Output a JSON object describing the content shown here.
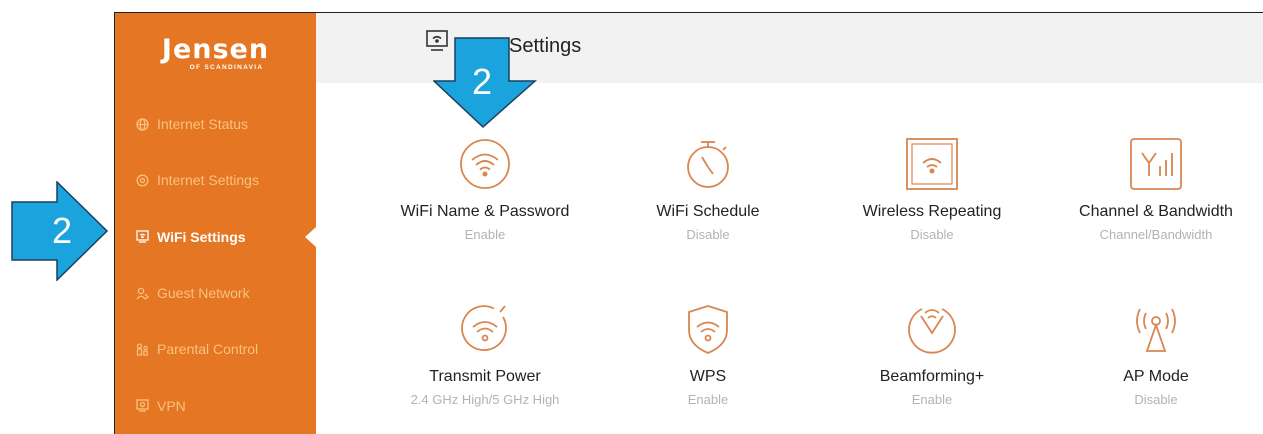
{
  "brand": {
    "name": "Jensen",
    "tagline": "OF SCANDINAVIA"
  },
  "sidebar": {
    "items": [
      {
        "label": "Internet Status",
        "icon": "globe-icon"
      },
      {
        "label": "Internet Settings",
        "icon": "settings-icon"
      },
      {
        "label": "WiFi Settings",
        "icon": "monitor-wifi-icon",
        "active": true
      },
      {
        "label": "Guest Network",
        "icon": "guest-icon"
      },
      {
        "label": "Parental Control",
        "icon": "family-icon"
      },
      {
        "label": "VPN",
        "icon": "vpn-icon"
      }
    ]
  },
  "header": {
    "title": "Settings",
    "icon": "monitor-wifi-icon"
  },
  "cards": [
    {
      "label": "WiFi Name & Password",
      "status": "Enable",
      "icon": "wifi-circle-icon"
    },
    {
      "label": "WiFi Schedule",
      "status": "Disable",
      "icon": "stopwatch-icon"
    },
    {
      "label": "Wireless Repeating",
      "status": "Disable",
      "icon": "repeater-icon"
    },
    {
      "label": "Channel & Bandwidth",
      "status": "Channel/Bandwidth",
      "icon": "channel-icon"
    },
    {
      "label": "Transmit Power",
      "status": "2.4 GHz High/5 GHz High",
      "icon": "transmit-power-icon"
    },
    {
      "label": "WPS",
      "status": "Enable",
      "icon": "wps-shield-icon"
    },
    {
      "label": "Beamforming+",
      "status": "Enable",
      "icon": "beamforming-icon"
    },
    {
      "label": "AP Mode",
      "status": "Disable",
      "icon": "antenna-icon"
    }
  ],
  "callouts": [
    {
      "number": "2",
      "color": "#1aa3dd"
    },
    {
      "number": "2",
      "color": "#1aa3dd"
    }
  ],
  "colors": {
    "sidebar": "#e57624",
    "accent": "#d9864f",
    "inactive_nav": "#f9c27d"
  }
}
